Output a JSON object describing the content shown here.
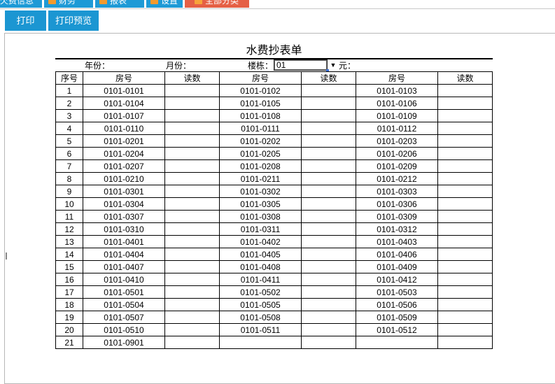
{
  "tabs": [
    {
      "label": "欠费信息",
      "active": false
    },
    {
      "label": "财务",
      "active": false
    },
    {
      "label": "报表",
      "active": false
    },
    {
      "label": "设置",
      "active": false
    },
    {
      "label": "全部分类",
      "active": true
    }
  ],
  "toolbar": {
    "print_label": "打印",
    "preview_label": "打印预览"
  },
  "report": {
    "title": "水费抄表单",
    "year_label": "年份：",
    "month_label": "月份：",
    "building_label": "楼栋：",
    "building_value": "01",
    "yuan_label": "元：",
    "headers": [
      "序号",
      "房号",
      "读数",
      "房号",
      "读数",
      "房号",
      "读数"
    ],
    "rows": [
      [
        "1",
        "0101-0101",
        "",
        "0101-0102",
        "",
        "0101-0103",
        ""
      ],
      [
        "2",
        "0101-0104",
        "",
        "0101-0105",
        "",
        "0101-0106",
        ""
      ],
      [
        "3",
        "0101-0107",
        "",
        "0101-0108",
        "",
        "0101-0109",
        ""
      ],
      [
        "4",
        "0101-0110",
        "",
        "0101-0111",
        "",
        "0101-0112",
        ""
      ],
      [
        "5",
        "0101-0201",
        "",
        "0101-0202",
        "",
        "0101-0203",
        ""
      ],
      [
        "6",
        "0101-0204",
        "",
        "0101-0205",
        "",
        "0101-0206",
        ""
      ],
      [
        "7",
        "0101-0207",
        "",
        "0101-0208",
        "",
        "0101-0209",
        ""
      ],
      [
        "8",
        "0101-0210",
        "",
        "0101-0211",
        "",
        "0101-0212",
        ""
      ],
      [
        "9",
        "0101-0301",
        "",
        "0101-0302",
        "",
        "0101-0303",
        ""
      ],
      [
        "10",
        "0101-0304",
        "",
        "0101-0305",
        "",
        "0101-0306",
        ""
      ],
      [
        "11",
        "0101-0307",
        "",
        "0101-0308",
        "",
        "0101-0309",
        ""
      ],
      [
        "12",
        "0101-0310",
        "",
        "0101-0311",
        "",
        "0101-0312",
        ""
      ],
      [
        "13",
        "0101-0401",
        "",
        "0101-0402",
        "",
        "0101-0403",
        ""
      ],
      [
        "14",
        "0101-0404",
        "",
        "0101-0405",
        "",
        "0101-0406",
        ""
      ],
      [
        "15",
        "0101-0407",
        "",
        "0101-0408",
        "",
        "0101-0409",
        ""
      ],
      [
        "16",
        "0101-0410",
        "",
        "0101-0411",
        "",
        "0101-0412",
        ""
      ],
      [
        "17",
        "0101-0501",
        "",
        "0101-0502",
        "",
        "0101-0503",
        ""
      ],
      [
        "18",
        "0101-0504",
        "",
        "0101-0505",
        "",
        "0101-0506",
        ""
      ],
      [
        "19",
        "0101-0507",
        "",
        "0101-0508",
        "",
        "0101-0509",
        ""
      ],
      [
        "20",
        "0101-0510",
        "",
        "0101-0511",
        "",
        "0101-0512",
        ""
      ],
      [
        "21",
        "0101-0901",
        "",
        "",
        "",
        "",
        ""
      ]
    ]
  },
  "colors": {
    "tab_blue": "#1e9ad6",
    "tab_active": "#e56045",
    "button_blue": "#1b96d2",
    "tab_icon": "#f39a2c"
  }
}
